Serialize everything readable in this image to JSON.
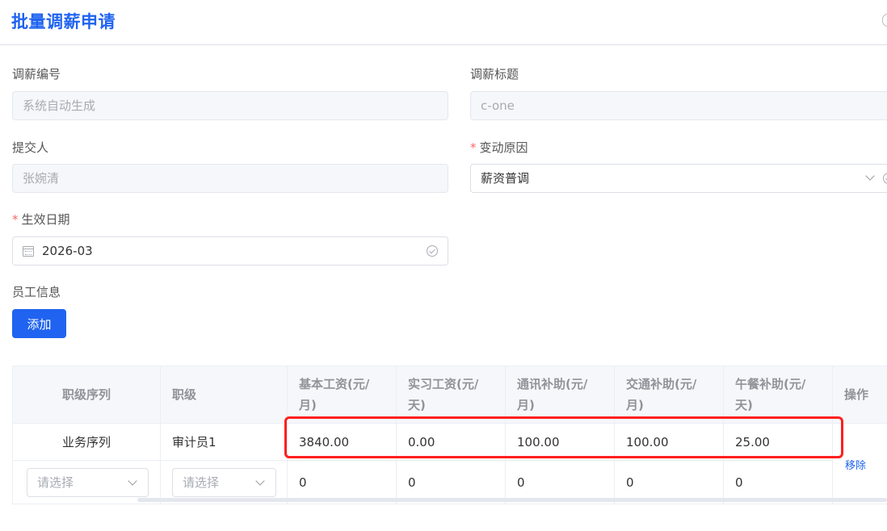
{
  "header": {
    "title": "批量调薪申请"
  },
  "form": {
    "adjust_no": {
      "label": "调薪编号",
      "value": "系统自动生成"
    },
    "adjust_title": {
      "label": "调薪标题",
      "value": "c-one"
    },
    "submitter": {
      "label": "提交人",
      "value": "张婉清"
    },
    "reason": {
      "label": "变动原因",
      "value": "薪资普调",
      "required": true
    },
    "effective_date": {
      "label": "生效日期",
      "value": "2026-03",
      "required": true
    },
    "employee_info_label": "员工信息",
    "add_button": "添加"
  },
  "table": {
    "columns": [
      {
        "key": "seq",
        "label": "职级序列"
      },
      {
        "key": "level",
        "label": "职级"
      },
      {
        "key": "base_salary",
        "label": "基本工资(元/月)"
      },
      {
        "key": "intern_salary",
        "label": "实习工资(元/天)"
      },
      {
        "key": "comm_allowance",
        "label": "通讯补助(元/月)"
      },
      {
        "key": "transport_allowance",
        "label": "交通补助(元/月)"
      },
      {
        "key": "meal_allowance",
        "label": "午餐补助(元/天)"
      },
      {
        "key": "action",
        "label": "操作"
      }
    ],
    "rows": [
      {
        "seq": "业务序列",
        "level": "审计员1",
        "base_salary": "3840.00",
        "intern_salary": "0.00",
        "comm_allowance": "100.00",
        "transport_allowance": "100.00",
        "meal_allowance": "25.00"
      },
      {
        "seq_placeholder": "请选择",
        "level_placeholder": "请选择",
        "base_salary": "0",
        "intern_salary": "0",
        "comm_allowance": "0",
        "transport_allowance": "0",
        "meal_allowance": "0"
      }
    ],
    "remove_label": "移除"
  },
  "colors": {
    "accent": "#1f63f0",
    "highlight": "#ff1f1f",
    "required": "#f56c6c"
  }
}
